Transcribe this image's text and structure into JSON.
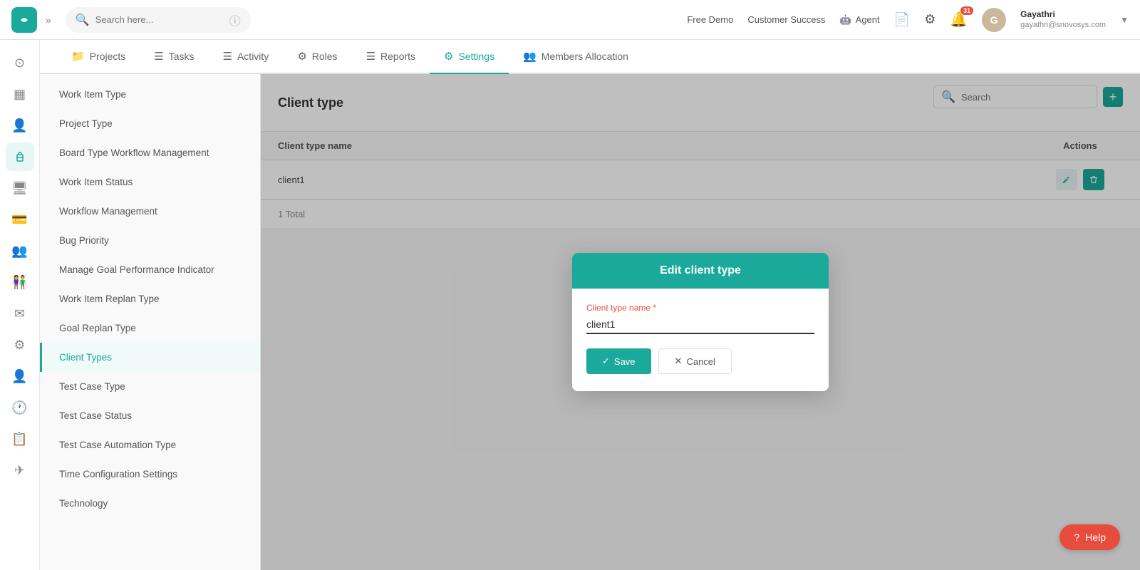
{
  "app": {
    "logo_letter": "S",
    "search_placeholder": "Search here...",
    "free_demo": "Free Demo",
    "customer_success": "Customer Success",
    "agent": "Agent",
    "notification_count": "31",
    "user": {
      "name": "Gayathri",
      "email": "gayathri@snovosys.com"
    }
  },
  "nav_tabs": [
    {
      "label": "Projects",
      "icon": "📁",
      "active": false
    },
    {
      "label": "Tasks",
      "icon": "☰",
      "active": false
    },
    {
      "label": "Activity",
      "icon": "☰",
      "active": false
    },
    {
      "label": "Roles",
      "icon": "⚙",
      "active": false
    },
    {
      "label": "Reports",
      "icon": "☰",
      "active": false
    },
    {
      "label": "Settings",
      "icon": "⚙",
      "active": true
    },
    {
      "label": "Members Allocation",
      "icon": "👥",
      "active": false
    }
  ],
  "settings_menu": [
    {
      "label": "Work Item Type",
      "active": false
    },
    {
      "label": "Project Type",
      "active": false
    },
    {
      "label": "Board Type Workflow Management",
      "active": false
    },
    {
      "label": "Work Item Status",
      "active": false
    },
    {
      "label": "Workflow Management",
      "active": false
    },
    {
      "label": "Bug Priority",
      "active": false
    },
    {
      "label": "Manage Goal Performance Indicator",
      "active": false
    },
    {
      "label": "Work Item Replan Type",
      "active": false
    },
    {
      "label": "Goal Replan Type",
      "active": false
    },
    {
      "label": "Client Types",
      "active": true
    },
    {
      "label": "Test Case Type",
      "active": false
    },
    {
      "label": "Test Case Status",
      "active": false
    },
    {
      "label": "Test Case Automation Type",
      "active": false
    },
    {
      "label": "Time Configuration Settings",
      "active": false
    },
    {
      "label": "Technology",
      "active": false
    }
  ],
  "main_content": {
    "title": "Client type",
    "search_placeholder": "Search",
    "table": {
      "columns": [
        "Client type name",
        "Actions"
      ],
      "rows": [
        {
          "name": "client1"
        }
      ],
      "footer": "1 Total"
    }
  },
  "modal": {
    "title": "Edit client type",
    "label": "Client type name",
    "required": "*",
    "value": "client1",
    "save_label": "Save",
    "cancel_label": "Cancel"
  },
  "help_button": "Help",
  "left_icons": [
    {
      "name": "home-icon",
      "symbol": "⊙",
      "active": false
    },
    {
      "name": "dashboard-icon",
      "symbol": "▦",
      "active": false
    },
    {
      "name": "person-icon",
      "symbol": "👤",
      "active": false
    },
    {
      "name": "briefcase-icon",
      "symbol": "💼",
      "active": true
    },
    {
      "name": "monitor-icon",
      "symbol": "🖥",
      "active": false
    },
    {
      "name": "card-icon",
      "symbol": "💳",
      "active": false
    },
    {
      "name": "group-icon",
      "symbol": "👥",
      "active": false
    },
    {
      "name": "team-icon",
      "symbol": "👫",
      "active": false
    },
    {
      "name": "mail-icon",
      "symbol": "✉",
      "active": false
    },
    {
      "name": "settings-icon",
      "symbol": "⚙",
      "active": false
    },
    {
      "name": "user2-icon",
      "symbol": "👤",
      "active": false
    },
    {
      "name": "clock-icon",
      "symbol": "🕐",
      "active": false
    },
    {
      "name": "report-icon",
      "symbol": "📋",
      "active": false
    },
    {
      "name": "send-icon",
      "symbol": "✈",
      "active": false
    }
  ]
}
